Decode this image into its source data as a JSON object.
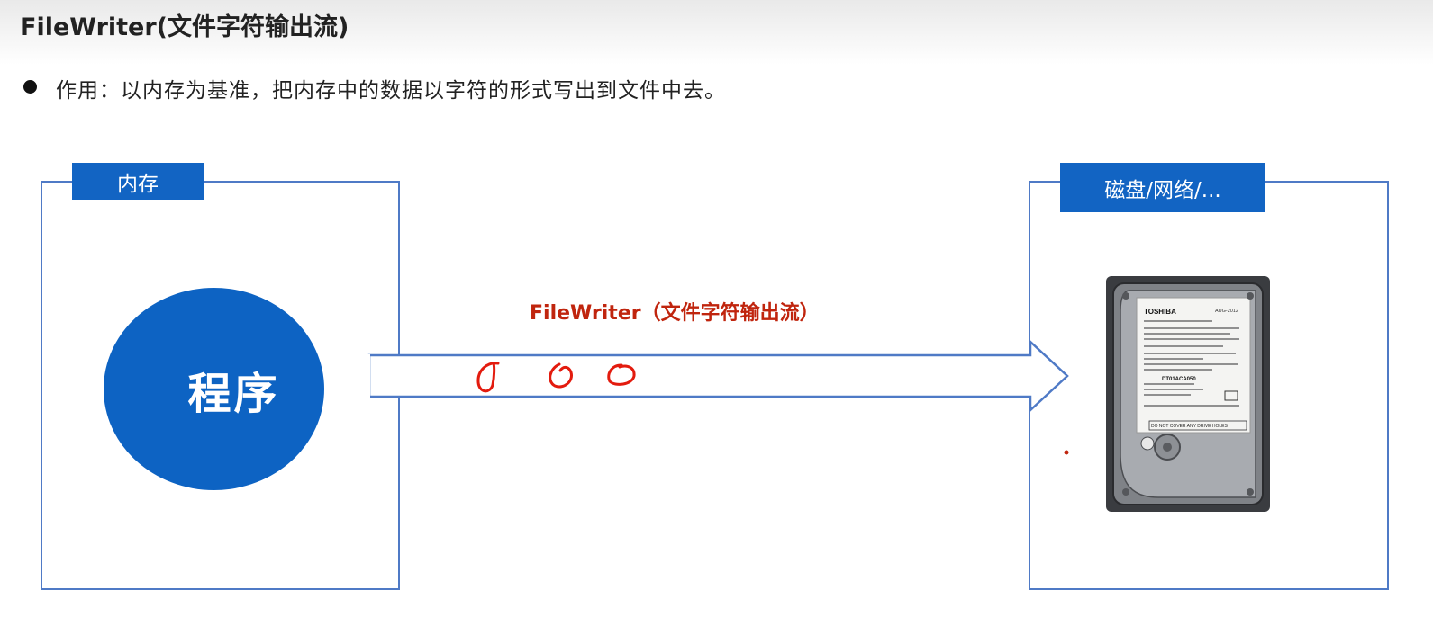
{
  "slide": {
    "title": "FileWriter(文件字符输出流)",
    "bullet": "作用：以内存为基准，把内存中的数据以字符的形式写出到文件中去。"
  },
  "diagram": {
    "source": {
      "tag": "内存",
      "node": "程序"
    },
    "stream_label": "FileWriter（文件字符输出流）",
    "target": {
      "tag": "磁盘/网络/..."
    },
    "hdd_label": {
      "brand": "TOSHIBA",
      "date": "AUG-2012",
      "model": "DT01ACA050",
      "notice": "DO NOT COVER ANY DRIVE HOLES"
    }
  },
  "colors": {
    "accent_blue": "#1264c3",
    "panel_border": "#4f7ac6",
    "stream_label": "#c0250e",
    "annotation_red": "#e31b0e"
  }
}
